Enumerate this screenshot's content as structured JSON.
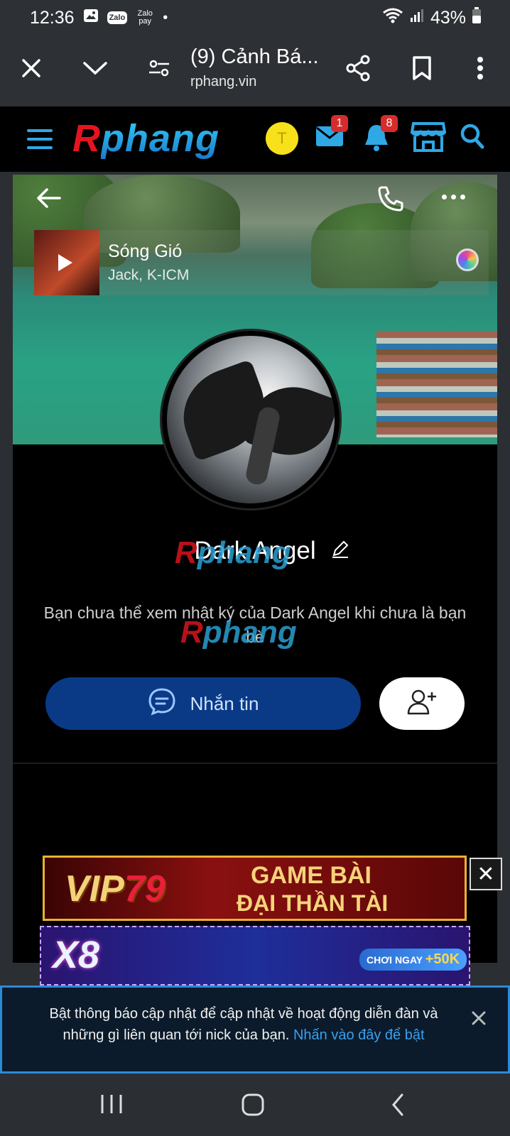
{
  "status_bar": {
    "time": "12:36",
    "apps": [
      "gallery-icon",
      "zalo-icon",
      "zalopay-icon"
    ],
    "zalo_label": "Zalo",
    "zalopay_label": "Zalo pay",
    "dot": "•",
    "battery": "43%"
  },
  "browser": {
    "title": "(9) Cảnh Bá...",
    "url": "rphang.vin"
  },
  "site_header": {
    "logo_r": "R",
    "logo_rest": "phang",
    "avatar_letter": "T",
    "mail_badge": "1",
    "bell_badge": "8",
    "colors": {
      "accent": "#2fa8e6",
      "logo_red": "#e5141f",
      "badge": "#d72c2c",
      "avatar": "#f7e11a"
    }
  },
  "profile": {
    "song_title": "Sóng Gió",
    "song_artist": "Jack, K-ICM",
    "name": "Dark Angel",
    "info_text": "Bạn chưa thể xem nhật ký của Dark Angel khi chưa là bạn bè",
    "message_button": "Nhắn tin",
    "watermark_r": "R",
    "watermark_rest": "phang"
  },
  "ads": {
    "ad1_brand_a": "VIP",
    "ad1_brand_b": "79",
    "ad1_line1": "GAME BÀI",
    "ad1_line2": "ĐẠI THẦN TÀI",
    "ad2_brand": "X8",
    "ad2_cta": "CHƠI NGAY",
    "ad2_bonus": "+50K",
    "close_symbol": "✕"
  },
  "notification": {
    "text": "Bật thông báo cập nhật để cập nhật về hoạt động diễn đàn và những gì liên quan tới nick của bạn.",
    "link": "Nhấn vào đây để bật",
    "close_symbol": "✕"
  }
}
